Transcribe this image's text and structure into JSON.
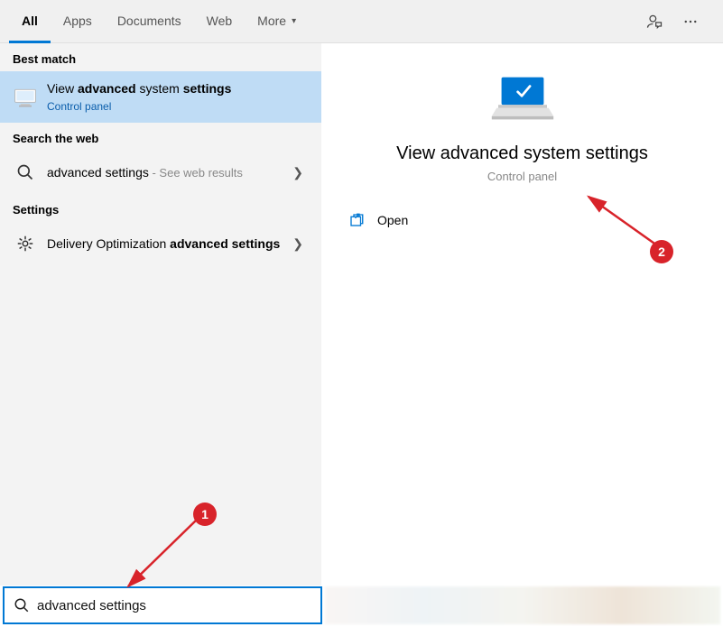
{
  "tabs": {
    "all": "All",
    "apps": "Apps",
    "documents": "Documents",
    "web": "Web",
    "more": "More"
  },
  "sections": {
    "best_match": "Best match",
    "search_web": "Search the web",
    "settings": "Settings"
  },
  "results": {
    "best_match": {
      "title_prefix": "View ",
      "title_bold1": "advanced",
      "title_mid": " system ",
      "title_bold2": "settings",
      "sub": "Control panel"
    },
    "web": {
      "query": "advanced settings",
      "hint": " - See web results"
    },
    "settings": {
      "prefix": "Delivery Optimization ",
      "bold": "advanced settings"
    }
  },
  "preview": {
    "title": "View advanced system settings",
    "sub": "Control panel",
    "open": "Open"
  },
  "search": {
    "value": "advanced settings"
  },
  "annotations": {
    "one": "1",
    "two": "2"
  }
}
